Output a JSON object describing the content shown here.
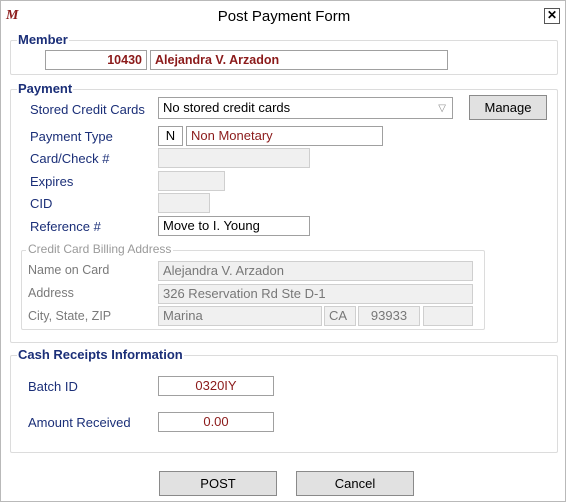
{
  "window": {
    "title": "Post Payment Form",
    "close_glyph": "✕",
    "app_icon_glyph": "M"
  },
  "member": {
    "legend": "Member",
    "id": "10430",
    "name": "Alejandra V. Arzadon"
  },
  "payment": {
    "legend": "Payment",
    "stored_cards_label": "Stored Credit Cards",
    "stored_cards_value": "No stored credit cards",
    "manage_label": "Manage",
    "payment_type_label": "Payment Type",
    "payment_type_code": "N",
    "payment_type_name": "Non Monetary",
    "card_check_label": "Card/Check #",
    "card_check_value": "",
    "expires_label": "Expires",
    "expires_value": "",
    "cid_label": "CID",
    "cid_value": "",
    "reference_label": "Reference #",
    "reference_value": "Move to I. Young"
  },
  "billing": {
    "legend": "Credit Card Billing Address",
    "name_label": "Name on Card",
    "name_value": "Alejandra V. Arzadon",
    "address_label": "Address",
    "address_value": "326 Reservation Rd Ste D-1",
    "city_label": "City, State, ZIP",
    "city_value": "Marina",
    "state_value": "CA",
    "zip_value": "93933",
    "zip_ext_value": ""
  },
  "cash": {
    "legend": "Cash Receipts Information",
    "batch_label": "Batch ID",
    "batch_value": "0320IY",
    "amount_label": "Amount Received",
    "amount_value": "0.00"
  },
  "buttons": {
    "post_label": "POST",
    "cancel_label": "Cancel"
  }
}
